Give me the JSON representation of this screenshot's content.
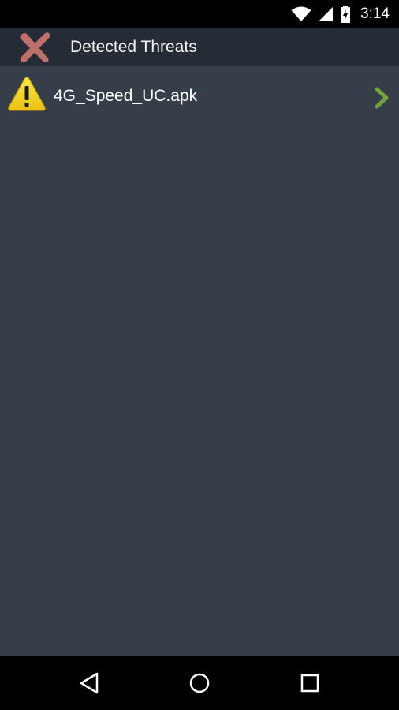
{
  "status_bar": {
    "time": "3:14",
    "icons": [
      "wifi-icon",
      "signal-icon",
      "battery-charging-icon"
    ]
  },
  "action_bar": {
    "title": "Detected Threats",
    "close_icon": "close-x-icon"
  },
  "threats": [
    {
      "name": "4G_Speed_UC.apk",
      "icon": "warning-icon",
      "action_icon": "chevron-right-icon"
    }
  ],
  "nav_bar": {
    "icons": [
      "back-icon",
      "home-icon",
      "recents-icon"
    ]
  },
  "colors": {
    "background": "#363e4a",
    "action_bar": "#262c35",
    "close_x": "#c0706a",
    "warning_yellow": "#f4d21a",
    "chevron_green": "#6fa33b"
  }
}
